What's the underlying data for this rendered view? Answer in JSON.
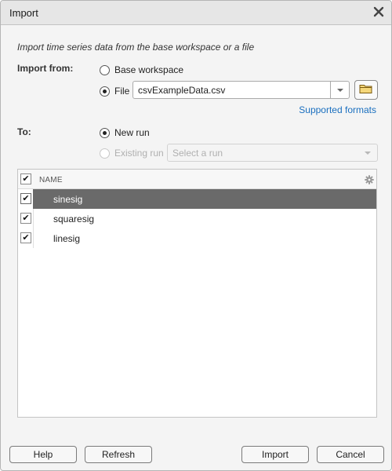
{
  "window": {
    "title": "Import",
    "close_icon": "close-icon"
  },
  "description": "Import time series data from the base workspace or a file",
  "import_from": {
    "label": "Import from:",
    "options": [
      {
        "label": "Base workspace",
        "selected": false
      },
      {
        "label": "File",
        "selected": true
      }
    ],
    "file_value": "csvExampleData.csv",
    "browse_icon": "folder-icon",
    "supported_formats_link": "Supported formats"
  },
  "to": {
    "label": "To:",
    "options": [
      {
        "label": "New run",
        "selected": true,
        "enabled": true
      },
      {
        "label": "Existing run",
        "selected": false,
        "enabled": false
      }
    ],
    "run_placeholder": "Select a run"
  },
  "signals_table": {
    "header": {
      "name": "NAME",
      "all_checked": true,
      "settings_icon": "gear-icon"
    },
    "rows": [
      {
        "name": "sinesig",
        "checked": true,
        "selected": true
      },
      {
        "name": "squaresig",
        "checked": true,
        "selected": false
      },
      {
        "name": "linesig",
        "checked": true,
        "selected": false
      }
    ]
  },
  "buttons": {
    "help": "Help",
    "refresh": "Refresh",
    "import": "Import",
    "cancel": "Cancel"
  },
  "colors": {
    "link": "#1a6fbf",
    "selected_row": "#6a6a6a",
    "dialog_bg": "#f4f4f4"
  }
}
